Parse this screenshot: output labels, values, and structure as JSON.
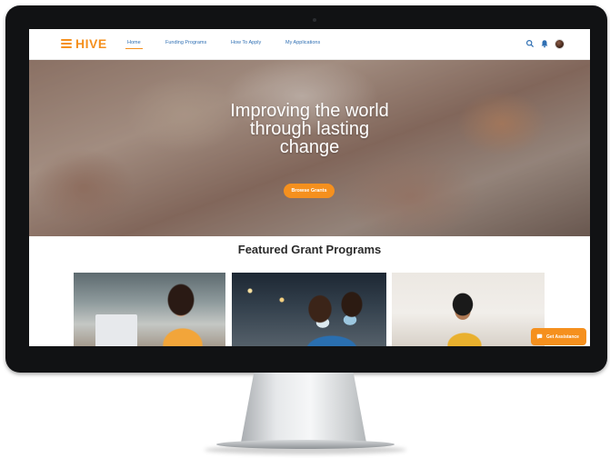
{
  "brand": {
    "name": "HIVE",
    "color": "#f5901e"
  },
  "nav": {
    "links": [
      {
        "label": "Home",
        "active": true
      },
      {
        "label": "Funding Programs",
        "active": false
      },
      {
        "label": "How To Apply",
        "active": false
      },
      {
        "label": "My Applications",
        "active": false
      }
    ],
    "icons": [
      "search-icon",
      "bell-icon",
      "avatar"
    ]
  },
  "hero": {
    "title_lines": [
      "Improving the world",
      "through lasting",
      "change"
    ],
    "button_label": "Browse Grants"
  },
  "featured": {
    "title": "Featured Grant Programs",
    "cards": [
      "card-1-image",
      "card-2-image",
      "card-3-image"
    ]
  },
  "chat": {
    "label": "Get Assistance",
    "icon": "chat-icon"
  }
}
